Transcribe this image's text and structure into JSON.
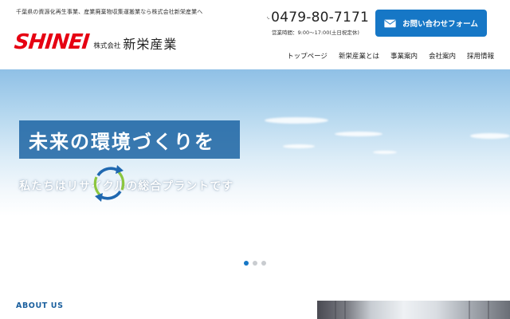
{
  "header": {
    "tagline": "千葉県の資源化再生事業、産業廃棄物収集運搬業なら株式会社新栄産業へ",
    "logo": {
      "mark": "SHINEI",
      "kabushiki": "株式会社",
      "name": "新栄産業"
    },
    "phone": {
      "number": "0479-80-7171",
      "hours": "営業時間：9:00〜17:00(土日祝定休)"
    },
    "contact_button": "お問い合わせフォーム",
    "nav": [
      "トップページ",
      "新栄産業とは",
      "事業案内",
      "会社案内",
      "採用情報"
    ]
  },
  "hero": {
    "title": "未来の環境づくりを",
    "subtitle": "私たちはリサイクルの総合プラントです",
    "slides": {
      "count": 3,
      "active_index": 0
    }
  },
  "about": {
    "heading": "ABOUT US"
  },
  "colors": {
    "brand_red": "#e60012",
    "accent_blue": "#1677c6",
    "heading_blue": "#1a5f9e"
  },
  "icons": {
    "phone": "phone-icon",
    "mail": "mail-icon",
    "recycle": "recycle-arrows-icon"
  }
}
